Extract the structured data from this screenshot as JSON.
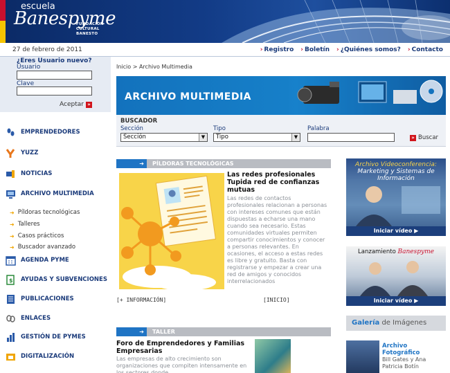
{
  "header": {
    "logo_small": "escuela",
    "logo_big": "Banespyme",
    "logo_sub_1": "FUNDACIÓN",
    "logo_sub_2": "CULTURAL",
    "logo_sub_3": "BANESTO"
  },
  "topbar": {
    "date": "27 de febrero de 2011",
    "links": [
      "Registro",
      "Boletín",
      "¿Quiénes somos?",
      "Contacto"
    ]
  },
  "login": {
    "question": "¿Eres Usuario nuevo?",
    "user_label": "Usuario",
    "pass_label": "Clave",
    "accept": "Aceptar"
  },
  "menu": {
    "items": [
      "EMPRENDEDORES",
      "YUZZ",
      "NOTICIAS",
      "ARCHIVO MULTIMEDIA",
      "AGENDA PYME",
      "AYUDAS Y SUBVENCIONES",
      "PUBLICACIONES",
      "ENLACES",
      "GESTIÓN DE PYMES",
      "DIGITALIZACIÓN"
    ],
    "subitems": [
      "Píldoras tecnológicas",
      "Talleres",
      "Casos prácticos",
      "Buscador avanzado"
    ]
  },
  "main": {
    "breadcrumb": "Inicio > Archivo Multimedia",
    "banner_title": "ARCHIVO MULTIMEDIA",
    "search": {
      "title": "BUSCADOR",
      "section_label": "Sección",
      "section_value": "Sección",
      "type_label": "Tipo",
      "type_value": "Tipo",
      "word_label": "Palabra",
      "button": "Buscar"
    },
    "section1": {
      "label": "PÍLDORAS TECNOLÓGICAS",
      "title": "Las redes profesionales Tupida red de confianzas mutuas",
      "body": "Las redes de contactos profesionales relacionan a personas con intereses comunes que están dispuestas a echarse una mano cuando sea necesario. Estas comunidades virtuales permiten compartir conocimientos y conocer a personas relevantes. En ocasiones, el acceso a estas redes es libre y gratuito. Basta con registrarse y empezar a crear una red de amigos y conocidos interrelacionados",
      "more": "[+ INFORMACIÓN]",
      "home": "[INICIO]"
    },
    "section2": {
      "label": "TALLER",
      "title": "Foro de Emprendedores y Familias Empresarias",
      "body": "Las empresas de alto crecimiento son organizaciones que compiten intensamente en los sectores donde"
    }
  },
  "right": {
    "promo1_line1": "Archivo Videoconferencia:",
    "promo1_line2": "Marketing y Sistemas de Información",
    "promo_button": "Iniciar vídeo",
    "promo2_prefix": "Lanzamiento",
    "promo2_brand": "Banespyme",
    "galeria_bold": "Galería",
    "galeria_rest": " de Imágenes",
    "foto_title": "Archivo Fotográfico",
    "foto_desc": "Bill Gates y Ana Patricia Botín"
  },
  "colors": {
    "navy": "#1a3a7a",
    "blue": "#1f74c4",
    "red": "#c8102e"
  }
}
